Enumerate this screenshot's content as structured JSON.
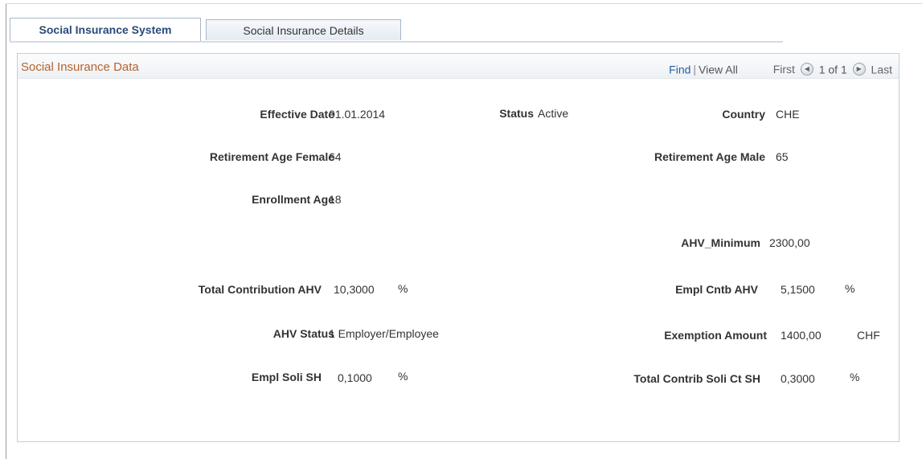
{
  "tabs": [
    {
      "label": "Social Insurance System"
    },
    {
      "label": "Social Insurance Details"
    }
  ],
  "panel": {
    "title": "Social Insurance Data",
    "nav": {
      "find": "Find",
      "separator": "|",
      "view_all": "View All",
      "first": "First",
      "page_info": "1 of 1",
      "last": "Last"
    }
  },
  "fields": {
    "effective_date": {
      "label": "Effective Date",
      "value": "01.01.2014"
    },
    "status": {
      "label": "Status",
      "value": "Active"
    },
    "country": {
      "label": "Country",
      "value": "CHE"
    },
    "retirement_age_female": {
      "label": "Retirement Age Female",
      "value": "64"
    },
    "retirement_age_male": {
      "label": "Retirement Age Male",
      "value": "65"
    },
    "enrollment_age": {
      "label": "Enrollment Age",
      "value": "18"
    },
    "ahv_minimum": {
      "label": "AHV_Minimum",
      "value": "2300,00"
    },
    "total_contribution_ahv": {
      "label": "Total Contribution AHV",
      "value": "10,3000",
      "unit": "%"
    },
    "empl_cntb_ahv": {
      "label": "Empl Cntb AHV",
      "value": "5,1500",
      "unit": "%"
    },
    "ahv_status": {
      "label": "AHV Status",
      "value": "1 Employer/Employee"
    },
    "exemption_amount": {
      "label": "Exemption Amount",
      "value": "1400,00",
      "unit": "CHF"
    },
    "empl_soli_sh": {
      "label": "Empl Soli SH",
      "value": "0,1000",
      "unit": "%"
    },
    "total_contrib_soli_ct_sh": {
      "label": "Total Contrib Soli Ct SH",
      "value": "0,3000",
      "unit": "%"
    }
  }
}
